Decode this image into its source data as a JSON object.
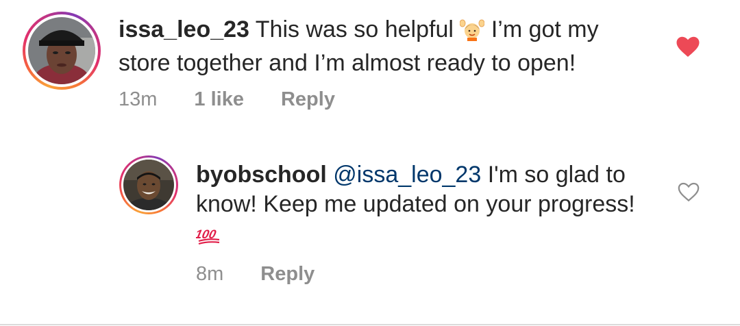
{
  "comments": [
    {
      "username": "issa_leo_23",
      "text_before_emoji": "This was so helpful",
      "emoji": "person-raising-hands-emoji",
      "text_after_emoji": "I’m got my store together and I’m almost ready to open!",
      "time": "13m",
      "likes": "1 like",
      "reply_label": "Reply",
      "liked": true
    },
    {
      "username": "byobschool",
      "mention": "@issa_leo_23",
      "text": "I'm so glad to know! Keep me updated on your progress!",
      "emoji": "hundred-points-emoji",
      "time": "8m",
      "reply_label": "Reply",
      "liked": false
    }
  ],
  "colors": {
    "text": "#262626",
    "meta": "#8e8e8e",
    "mention": "#00376b",
    "heart_liked": "#ed4956",
    "heart_outline": "#8e8e8e"
  }
}
